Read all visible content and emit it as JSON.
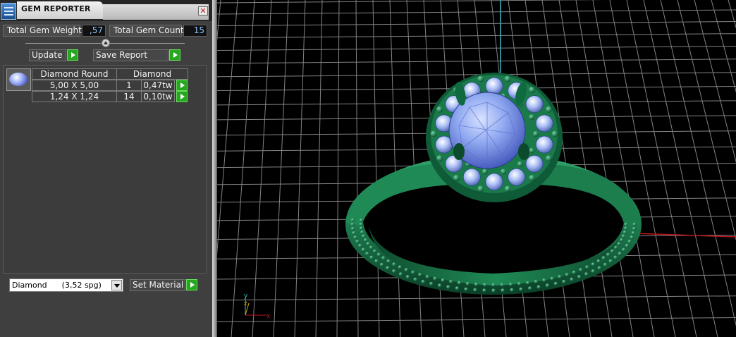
{
  "panel": {
    "title": "GEM REPORTER",
    "close_icon": "close-icon",
    "total_weight_label": "Total Gem Weight",
    "total_weight_value": ",57",
    "total_count_label": "Total Gem Count",
    "total_count_value": "15",
    "update_label": "Update",
    "save_report_label": "Save Report",
    "table": {
      "stone_type": "Diamond Round",
      "material": "Diamond",
      "rows": [
        {
          "size": "5,00 X 5,00",
          "count": "1",
          "weight": "0,47tw"
        },
        {
          "size": "1,24 X 1,24",
          "count": "14",
          "weight": "0,10tw"
        }
      ]
    },
    "material_select": {
      "name": "Diamond",
      "density": "(3,52 spg)"
    },
    "set_material_label": "Set Material"
  },
  "viewport": {
    "axis_labels": {
      "y": "y",
      "z": "z",
      "x": "x"
    },
    "colors": {
      "grid": "#9a9a9a",
      "metal": "#1f7a4e",
      "gem": "#8fa8f0",
      "x_axis": "#c0161a",
      "y_axis": "#35b6c8"
    }
  }
}
